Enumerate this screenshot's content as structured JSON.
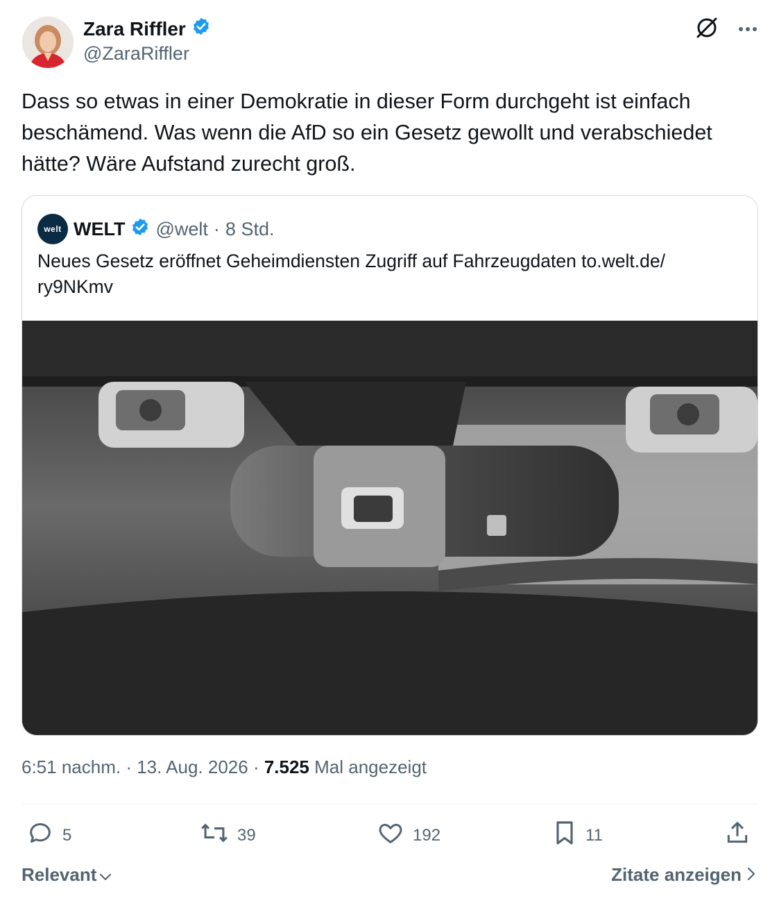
{
  "author": {
    "name": "Zara Riffler",
    "handle": "@ZaraRiffler",
    "verified_color": "#1d9bf0"
  },
  "post": {
    "text": "Dass so etwas in einer Demokratie in dieser Form durchgeht ist einfach beschämend. Was wenn die AfD so ein Gesetz gewollt und verabschiedet hätte? Wäre Aufstand zurecht groß.",
    "time": "6:51 nachm.",
    "date": "13. Aug. 2026",
    "views_count": "7.525",
    "views_label": "Mal angezeigt"
  },
  "quote": {
    "logo_text": "welt",
    "name": "WELT",
    "handle": "@welt",
    "age": "8 Std.",
    "text_line1": "Neues Gesetz eröffnet Geheimdiensten Zugriff auf Fahrzeugdaten to.welt.de/",
    "text_line2": "ry9NKmv",
    "image_label": "Innenraumkameras am Rückspiegel eines Fahrzeugs"
  },
  "actions": {
    "replies": "5",
    "reposts": "39",
    "likes": "192",
    "bookmarks": "11"
  },
  "footer": {
    "sort_label": "Relevant",
    "quotes_label": "Zitate anzeigen"
  },
  "icons": {
    "top_right": [
      "grok-icon",
      "more-icon"
    ],
    "actions": [
      "reply-icon",
      "repost-icon",
      "like-icon",
      "bookmark-icon",
      "share-icon"
    ]
  }
}
